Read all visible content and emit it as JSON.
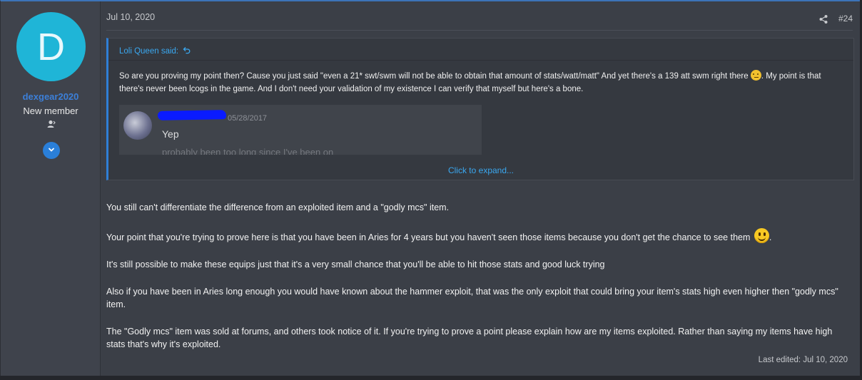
{
  "user": {
    "avatar_letter": "D",
    "avatar_color": "#1fb5d7",
    "username": "dexgear2020",
    "title": "New member"
  },
  "post": {
    "date": "Jul 10, 2020",
    "number": "#24",
    "last_edited": "Last edited: Jul 10, 2020"
  },
  "quote": {
    "author": "Loli Queen said:",
    "text_part1": "So are you proving my point then? Cause you just said \"even a 21* swt/swm will not be able to obtain that amount of stats/watt/matt\" And yet there's a 139 att swm right there ",
    "text_part2": ". My point is that there's never been lcogs in the game. And I don't need your validation of my existence I can verify that myself but here's a bone.",
    "embed": {
      "date": "05/28/2017",
      "message": "Yep",
      "faded_message": "probably been too long since I've been on"
    },
    "expand_label": "Click to expand..."
  },
  "body": {
    "p1": "You still can't differentiate the difference from an exploited item and a \"godly mcs\" item.",
    "p2_a": "Your point that you're trying to prove here is that you have been in Aries for 4 years but you haven't seen those items because you don't get the chance to see them ",
    "p2_b": ".",
    "p3": "It's still possible to make these equips just that it's a very small chance that you'll be able to hit those stats and good luck trying",
    "p4": "Also if you have been in Aries long enough you would have known about the hammer exploit, that was the only exploit that could bring your item's stats high even higher then \"godly mcs\" item.",
    "p5": "The \"Godly mcs\" item was sold at forums, and others took notice of it. If you're trying to prove a point please explain how are my items exploited. Rather than saying my items have high stats that's why it's exploited."
  },
  "colors": {
    "accent": "#2f7fd6",
    "link": "#3aa8f0",
    "username": "#3c7fd8"
  },
  "icons": {
    "share": "share-icon",
    "quote_jump": "arrow-up-left-icon",
    "user_badge": "user-icon",
    "expand": "chevron-down-icon"
  }
}
